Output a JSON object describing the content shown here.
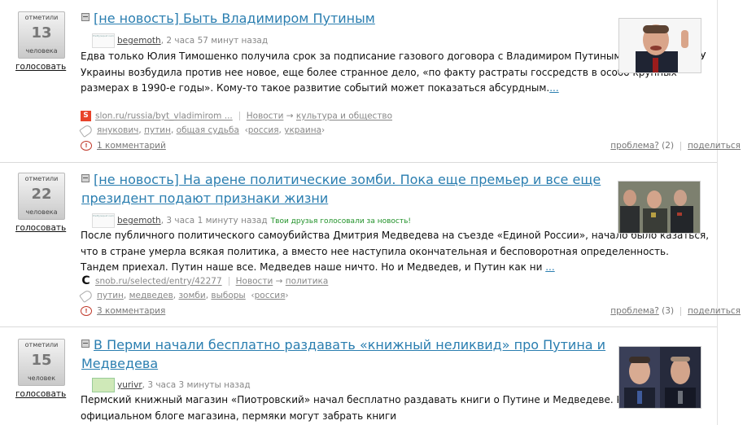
{
  "items": [
    {
      "votes": {
        "top": "отметили",
        "count": "13",
        "bottom": "человека",
        "vote_label": "голосовать"
      },
      "title": "[не новость] Быть Владимиром Путиным",
      "author": "begemoth",
      "time": ", 2 часа 57 минут назад",
      "friends_note": "",
      "text": "Едва только Юлия Тимошенко получила срок за подписание газового договора с Владимиром Путиным, как тут же СБУ Украины возбудила против нее новое, еще более странное дело, «по факту растраты госсредств в особо крупных размерах в 1990-е годы». Кому-то такое развитие событий может показаться абсурдным.",
      "more": "...",
      "source": "slon.ru/russia/byt_vladimirom ...",
      "source_icon": "S",
      "category_root": "Новости",
      "category_arrow": "→",
      "category": "культура и общество",
      "tags": [
        "янукович",
        "путин",
        "общая судьба"
      ],
      "regions": [
        "россия",
        "украина"
      ],
      "comments": "1 комментарий",
      "problem": "проблема?",
      "problem_count": "(2)",
      "share": "поделиться"
    },
    {
      "votes": {
        "top": "отметили",
        "count": "22",
        "bottom": "человека",
        "vote_label": "голосовать"
      },
      "title_line1": "[не новость] На арене политические зомби. Пока еще премьер и все еще",
      "title_line2": "президент подают признаки жизни",
      "author": "begemoth",
      "time": ", 3 часа 1 минуту назад",
      "friends_note": "Твои друзья голосовали за новость!",
      "text": "После публичного политического самоубийства Дмитрия Медведева на съезде «Единой России», начало было казаться, что в стране умерла всякая политика, а вместо нее наступила окончательная и бесповоротная определенность. Тандем приехал. Путин наше все. Медведев наше ничто. Но и Медведев, и Путин как ни",
      "more": "...",
      "source": "snob.ru/selected/entry/42277",
      "source_icon": "С",
      "category_root": "Новости",
      "category_arrow": "→",
      "category": "политика",
      "tags": [
        "путин",
        "медведев",
        "зомби",
        "выборы"
      ],
      "regions": [
        "россия"
      ],
      "comments": "3 комментария",
      "problem": "проблема?",
      "problem_count": "(3)",
      "share": "поделиться"
    },
    {
      "votes": {
        "top": "отметили",
        "count": "15",
        "bottom": "человек",
        "vote_label": "голосовать"
      },
      "title_line1": "В Перми начали бесплатно раздавать «книжный неликвид» про Путина и",
      "title_line2": "Медведева",
      "author": "yurivr",
      "time": ", 3 часа 3 минуты назад",
      "text": "Пермский книжный магазин «Пиотровский» начал бесплатно раздавать книги о Путине и Медведеве. Как сказано в официальном блоге магазина, пермяки могут забрать книги"
    }
  ]
}
